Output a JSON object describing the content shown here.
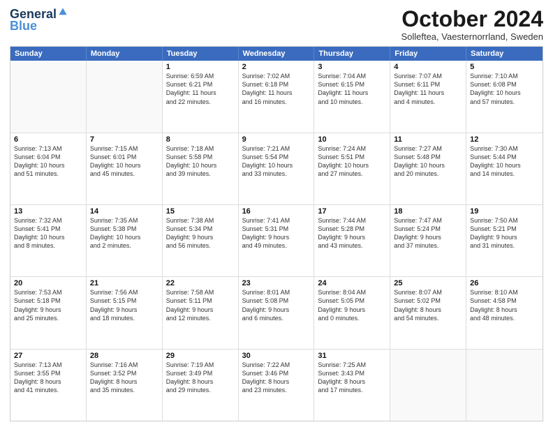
{
  "logo": {
    "general": "General",
    "blue": "Blue"
  },
  "title": "October 2024",
  "subtitle": "Solleftea, Vaesternorrland, Sweden",
  "header_days": [
    "Sunday",
    "Monday",
    "Tuesday",
    "Wednesday",
    "Thursday",
    "Friday",
    "Saturday"
  ],
  "weeks": [
    [
      {
        "day": "",
        "lines": []
      },
      {
        "day": "",
        "lines": []
      },
      {
        "day": "1",
        "lines": [
          "Sunrise: 6:59 AM",
          "Sunset: 6:21 PM",
          "Daylight: 11 hours",
          "and 22 minutes."
        ]
      },
      {
        "day": "2",
        "lines": [
          "Sunrise: 7:02 AM",
          "Sunset: 6:18 PM",
          "Daylight: 11 hours",
          "and 16 minutes."
        ]
      },
      {
        "day": "3",
        "lines": [
          "Sunrise: 7:04 AM",
          "Sunset: 6:15 PM",
          "Daylight: 11 hours",
          "and 10 minutes."
        ]
      },
      {
        "day": "4",
        "lines": [
          "Sunrise: 7:07 AM",
          "Sunset: 6:11 PM",
          "Daylight: 11 hours",
          "and 4 minutes."
        ]
      },
      {
        "day": "5",
        "lines": [
          "Sunrise: 7:10 AM",
          "Sunset: 6:08 PM",
          "Daylight: 10 hours",
          "and 57 minutes."
        ]
      }
    ],
    [
      {
        "day": "6",
        "lines": [
          "Sunrise: 7:13 AM",
          "Sunset: 6:04 PM",
          "Daylight: 10 hours",
          "and 51 minutes."
        ]
      },
      {
        "day": "7",
        "lines": [
          "Sunrise: 7:15 AM",
          "Sunset: 6:01 PM",
          "Daylight: 10 hours",
          "and 45 minutes."
        ]
      },
      {
        "day": "8",
        "lines": [
          "Sunrise: 7:18 AM",
          "Sunset: 5:58 PM",
          "Daylight: 10 hours",
          "and 39 minutes."
        ]
      },
      {
        "day": "9",
        "lines": [
          "Sunrise: 7:21 AM",
          "Sunset: 5:54 PM",
          "Daylight: 10 hours",
          "and 33 minutes."
        ]
      },
      {
        "day": "10",
        "lines": [
          "Sunrise: 7:24 AM",
          "Sunset: 5:51 PM",
          "Daylight: 10 hours",
          "and 27 minutes."
        ]
      },
      {
        "day": "11",
        "lines": [
          "Sunrise: 7:27 AM",
          "Sunset: 5:48 PM",
          "Daylight: 10 hours",
          "and 20 minutes."
        ]
      },
      {
        "day": "12",
        "lines": [
          "Sunrise: 7:30 AM",
          "Sunset: 5:44 PM",
          "Daylight: 10 hours",
          "and 14 minutes."
        ]
      }
    ],
    [
      {
        "day": "13",
        "lines": [
          "Sunrise: 7:32 AM",
          "Sunset: 5:41 PM",
          "Daylight: 10 hours",
          "and 8 minutes."
        ]
      },
      {
        "day": "14",
        "lines": [
          "Sunrise: 7:35 AM",
          "Sunset: 5:38 PM",
          "Daylight: 10 hours",
          "and 2 minutes."
        ]
      },
      {
        "day": "15",
        "lines": [
          "Sunrise: 7:38 AM",
          "Sunset: 5:34 PM",
          "Daylight: 9 hours",
          "and 56 minutes."
        ]
      },
      {
        "day": "16",
        "lines": [
          "Sunrise: 7:41 AM",
          "Sunset: 5:31 PM",
          "Daylight: 9 hours",
          "and 49 minutes."
        ]
      },
      {
        "day": "17",
        "lines": [
          "Sunrise: 7:44 AM",
          "Sunset: 5:28 PM",
          "Daylight: 9 hours",
          "and 43 minutes."
        ]
      },
      {
        "day": "18",
        "lines": [
          "Sunrise: 7:47 AM",
          "Sunset: 5:24 PM",
          "Daylight: 9 hours",
          "and 37 minutes."
        ]
      },
      {
        "day": "19",
        "lines": [
          "Sunrise: 7:50 AM",
          "Sunset: 5:21 PM",
          "Daylight: 9 hours",
          "and 31 minutes."
        ]
      }
    ],
    [
      {
        "day": "20",
        "lines": [
          "Sunrise: 7:53 AM",
          "Sunset: 5:18 PM",
          "Daylight: 9 hours",
          "and 25 minutes."
        ]
      },
      {
        "day": "21",
        "lines": [
          "Sunrise: 7:56 AM",
          "Sunset: 5:15 PM",
          "Daylight: 9 hours",
          "and 18 minutes."
        ]
      },
      {
        "day": "22",
        "lines": [
          "Sunrise: 7:58 AM",
          "Sunset: 5:11 PM",
          "Daylight: 9 hours",
          "and 12 minutes."
        ]
      },
      {
        "day": "23",
        "lines": [
          "Sunrise: 8:01 AM",
          "Sunset: 5:08 PM",
          "Daylight: 9 hours",
          "and 6 minutes."
        ]
      },
      {
        "day": "24",
        "lines": [
          "Sunrise: 8:04 AM",
          "Sunset: 5:05 PM",
          "Daylight: 9 hours",
          "and 0 minutes."
        ]
      },
      {
        "day": "25",
        "lines": [
          "Sunrise: 8:07 AM",
          "Sunset: 5:02 PM",
          "Daylight: 8 hours",
          "and 54 minutes."
        ]
      },
      {
        "day": "26",
        "lines": [
          "Sunrise: 8:10 AM",
          "Sunset: 4:58 PM",
          "Daylight: 8 hours",
          "and 48 minutes."
        ]
      }
    ],
    [
      {
        "day": "27",
        "lines": [
          "Sunrise: 7:13 AM",
          "Sunset: 3:55 PM",
          "Daylight: 8 hours",
          "and 41 minutes."
        ]
      },
      {
        "day": "28",
        "lines": [
          "Sunrise: 7:16 AM",
          "Sunset: 3:52 PM",
          "Daylight: 8 hours",
          "and 35 minutes."
        ]
      },
      {
        "day": "29",
        "lines": [
          "Sunrise: 7:19 AM",
          "Sunset: 3:49 PM",
          "Daylight: 8 hours",
          "and 29 minutes."
        ]
      },
      {
        "day": "30",
        "lines": [
          "Sunrise: 7:22 AM",
          "Sunset: 3:46 PM",
          "Daylight: 8 hours",
          "and 23 minutes."
        ]
      },
      {
        "day": "31",
        "lines": [
          "Sunrise: 7:25 AM",
          "Sunset: 3:43 PM",
          "Daylight: 8 hours",
          "and 17 minutes."
        ]
      },
      {
        "day": "",
        "lines": []
      },
      {
        "day": "",
        "lines": []
      }
    ]
  ]
}
